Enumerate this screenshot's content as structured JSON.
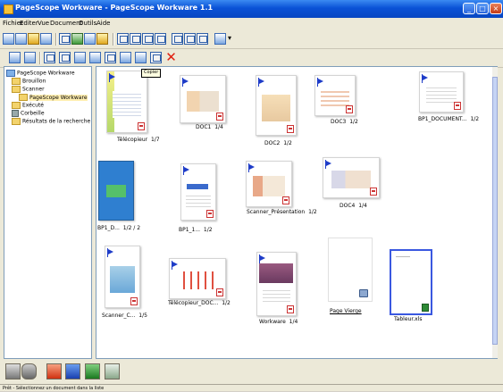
{
  "window": {
    "title": "PageScope Workware - PageScope Workware 1.1"
  },
  "menu": [
    "Fichier",
    "Editer",
    "Vue",
    "Document",
    "Outils",
    "Aide"
  ],
  "tree": {
    "root": "PageScope Workware",
    "items": [
      "Brouillon",
      "Scanner",
      "PageScope Workware",
      "Exécuté",
      "Corbeille",
      "Résultats de la recherche"
    ]
  },
  "tooltip": "Copier",
  "documents": [
    {
      "name": "Télécopieur",
      "pages": "1/7"
    },
    {
      "name": "DOC1",
      "pages": "1/4"
    },
    {
      "name": "DOC2",
      "pages": "1/2"
    },
    {
      "name": "DOC3",
      "pages": "1/2"
    },
    {
      "name": "BP1_DOCUMENT...",
      "pages": "1/2"
    },
    {
      "name": "BP1_D...",
      "pages": "1/2 / 2"
    },
    {
      "name": "BP1_1...",
      "pages": "1/2"
    },
    {
      "name": "Scanner_Présentation",
      "pages": "1/2"
    },
    {
      "name": "DOC4",
      "pages": "1/4"
    },
    {
      "name": "Scanner_C...",
      "pages": "1/5"
    },
    {
      "name": "Télécopieur_DOC...",
      "pages": "1/2"
    },
    {
      "name": "Workware",
      "pages": "1/4"
    },
    {
      "name": "Page Vierge",
      "pages": ""
    },
    {
      "name": "Tableur.xls",
      "pages": ""
    }
  ],
  "status": "Prêt - Sélectionnez un document dans la liste",
  "colors": {
    "titlebar": "#0a52d6",
    "selection": "#3a58e0",
    "accent_red": "#e02010"
  }
}
